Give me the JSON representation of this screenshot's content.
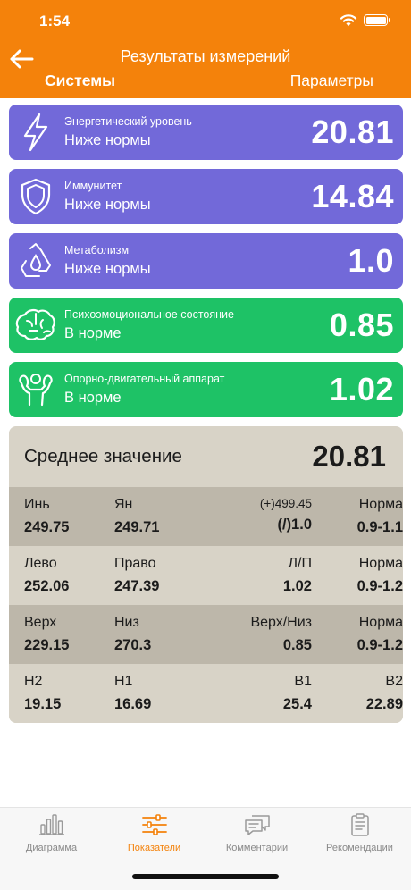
{
  "status_bar": {
    "time": "1:54"
  },
  "header": {
    "title": "Результаты измерений",
    "tabs": [
      "Системы",
      "Параметры"
    ],
    "active_tab": "Системы"
  },
  "colors": {
    "accent": "#f4820b",
    "below_norm": "#7269d9",
    "normal": "#1ec266",
    "summary_bg": "#d8d3c7",
    "summary_dark": "#bdb7aa"
  },
  "systems": [
    {
      "name": "Энергетический уровень",
      "status": "Ниже нормы",
      "value": "20.81",
      "icon": "lightning-icon"
    },
    {
      "name": "Иммунитет",
      "status": "Ниже нормы",
      "value": "14.84",
      "icon": "shield-icon"
    },
    {
      "name": "Метаболизм",
      "status": "Ниже нормы",
      "value": "1.0",
      "icon": "recycle-drop-icon"
    },
    {
      "name": "Психоэмоциональное состояние",
      "status": "В норме",
      "value": "0.85",
      "icon": "brain-icon"
    },
    {
      "name": "Опорно-двигательный аппарат",
      "status": "В норме",
      "value": "1.02",
      "icon": "muscle-icon"
    }
  ],
  "summary": {
    "label": "Среднее значение",
    "value": "20.81",
    "rows": [
      {
        "c1": {
          "label": "Инь",
          "value": "249.75"
        },
        "c2": {
          "label": "Ян",
          "value": "249.71"
        },
        "c3": {
          "label": "(+)499.45",
          "value": "(/)1.0"
        },
        "c4": {
          "label": "Норма",
          "value": "0.9-1.1"
        }
      },
      {
        "c1": {
          "label": "Лево",
          "value": "252.06"
        },
        "c2": {
          "label": "Право",
          "value": "247.39"
        },
        "c3": {
          "label": "Л/П",
          "value": "1.02"
        },
        "c4": {
          "label": "Норма",
          "value": "0.9-1.2"
        }
      },
      {
        "c1": {
          "label": "Верх",
          "value": "229.15"
        },
        "c2": {
          "label": "Низ",
          "value": "270.3"
        },
        "c3": {
          "label": "Верх/Низ",
          "value": "0.85"
        },
        "c4": {
          "label": "Норма",
          "value": "0.9-1.2"
        }
      },
      {
        "c1": {
          "label": "H2",
          "value": "19.15"
        },
        "c2": {
          "label": "H1",
          "value": "16.69"
        },
        "c3": {
          "label": "B1",
          "value": "25.4"
        },
        "c4": {
          "label": "B2",
          "value": "22.89"
        }
      }
    ]
  },
  "bottom_nav": [
    {
      "label": "Диаграмма",
      "icon": "bar-chart-icon"
    },
    {
      "label": "Показатели",
      "icon": "sliders-icon"
    },
    {
      "label": "Комментарии",
      "icon": "comments-icon"
    },
    {
      "label": "Рекомендации",
      "icon": "clipboard-icon"
    }
  ],
  "active_nav": "Показатели"
}
